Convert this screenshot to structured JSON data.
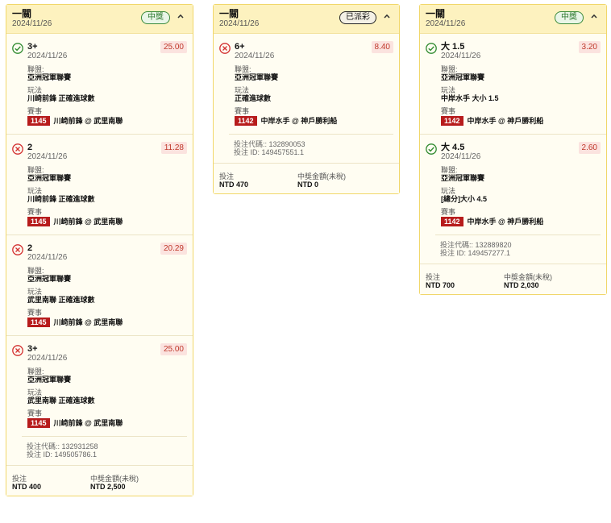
{
  "cards": [
    {
      "title": "一關",
      "date": "2024/11/26",
      "status": "中獎",
      "status_type": "won",
      "selections": [
        {
          "pick": "3+",
          "date": "2024/11/26",
          "odds": "25.00",
          "result": "win",
          "league_label": "聯盟:",
          "league": "亞洲冠軍聯賽",
          "market_label": "玩法",
          "market": "川崎前鋒 正確進球數",
          "event_label": "賽事",
          "event_code": "1145",
          "event": "川崎前鋒 @ 武里南聯"
        },
        {
          "pick": "2",
          "date": "2024/11/26",
          "odds": "11.28",
          "result": "lose",
          "league_label": "聯盟:",
          "league": "亞洲冠軍聯賽",
          "market_label": "玩法",
          "market": "川崎前鋒 正確進球數",
          "event_label": "賽事",
          "event_code": "1145",
          "event": "川崎前鋒 @ 武里南聯"
        },
        {
          "pick": "2",
          "date": "2024/11/26",
          "odds": "20.29",
          "result": "lose",
          "league_label": "聯盟:",
          "league": "亞洲冠軍聯賽",
          "market_label": "玩法",
          "market": "武里南聯 正確進球數",
          "event_label": "賽事",
          "event_code": "1145",
          "event": "川崎前鋒 @ 武里南聯"
        },
        {
          "pick": "3+",
          "date": "2024/11/26",
          "odds": "25.00",
          "result": "lose",
          "league_label": "聯盟:",
          "league": "亞洲冠軍聯賽",
          "market_label": "玩法",
          "market": "武里南聯 正確進球數",
          "event_label": "賽事",
          "event_code": "1145",
          "event": "川崎前鋒 @ 武里南聯"
        }
      ],
      "ticket_code": "投注代碼:: 132931258",
      "ticket_id": "投注 ID: 149505786.1",
      "stake_label": "投注",
      "stake": "NTD 400",
      "payout_label": "中獎金額(未稅)",
      "payout": "NTD 2,500"
    },
    {
      "title": "一關",
      "date": "2024/11/26",
      "status": "已派彩",
      "status_type": "settled",
      "selections": [
        {
          "pick": "6+",
          "date": "2024/11/26",
          "odds": "8.40",
          "result": "lose",
          "league_label": "聯盟:",
          "league": "亞洲冠軍聯賽",
          "market_label": "玩法",
          "market": "正確進球數",
          "event_label": "賽事",
          "event_code": "1142",
          "event": "中岸水手 @ 神戶勝利船"
        }
      ],
      "ticket_code": "投注代碼:: 132890053",
      "ticket_id": "投注 ID: 149457551.1",
      "stake_label": "投注",
      "stake": "NTD 470",
      "payout_label": "中獎金額(未稅)",
      "payout": "NTD 0"
    },
    {
      "title": "一關",
      "date": "2024/11/26",
      "status": "中獎",
      "status_type": "won",
      "selections": [
        {
          "pick": "大 1.5",
          "date": "2024/11/26",
          "odds": "3.20",
          "result": "win",
          "league_label": "聯盟:",
          "league": "亞洲冠軍聯賽",
          "market_label": "玩法",
          "market": "中岸水手 大小 1.5",
          "event_label": "賽事",
          "event_code": "1142",
          "event": "中岸水手 @ 神戶勝利船"
        },
        {
          "pick": "大 4.5",
          "date": "2024/11/26",
          "odds": "2.60",
          "result": "win",
          "league_label": "聯盟:",
          "league": "亞洲冠軍聯賽",
          "market_label": "玩法",
          "market": "[總分]大小 4.5",
          "event_label": "賽事",
          "event_code": "1142",
          "event": "中岸水手 @ 神戶勝利船"
        }
      ],
      "ticket_code": "投注代碼:: 132889820",
      "ticket_id": "投注 ID: 149457277.1",
      "stake_label": "投注",
      "stake": "NTD 700",
      "payout_label": "中獎金額(未稅)",
      "payout": "NTD 2,030"
    }
  ],
  "icons": {
    "win": "check-circle-icon",
    "lose": "cross-circle-icon",
    "collapse": "chevron-up-icon"
  },
  "colors": {
    "header_bg": "#fdf2bf",
    "card_border": "#f1d76a",
    "win_green": "#2f8a2f",
    "lose_red": "#d32f2f",
    "event_code_bg": "#b71c1c",
    "odds_red": "#c0392b"
  }
}
